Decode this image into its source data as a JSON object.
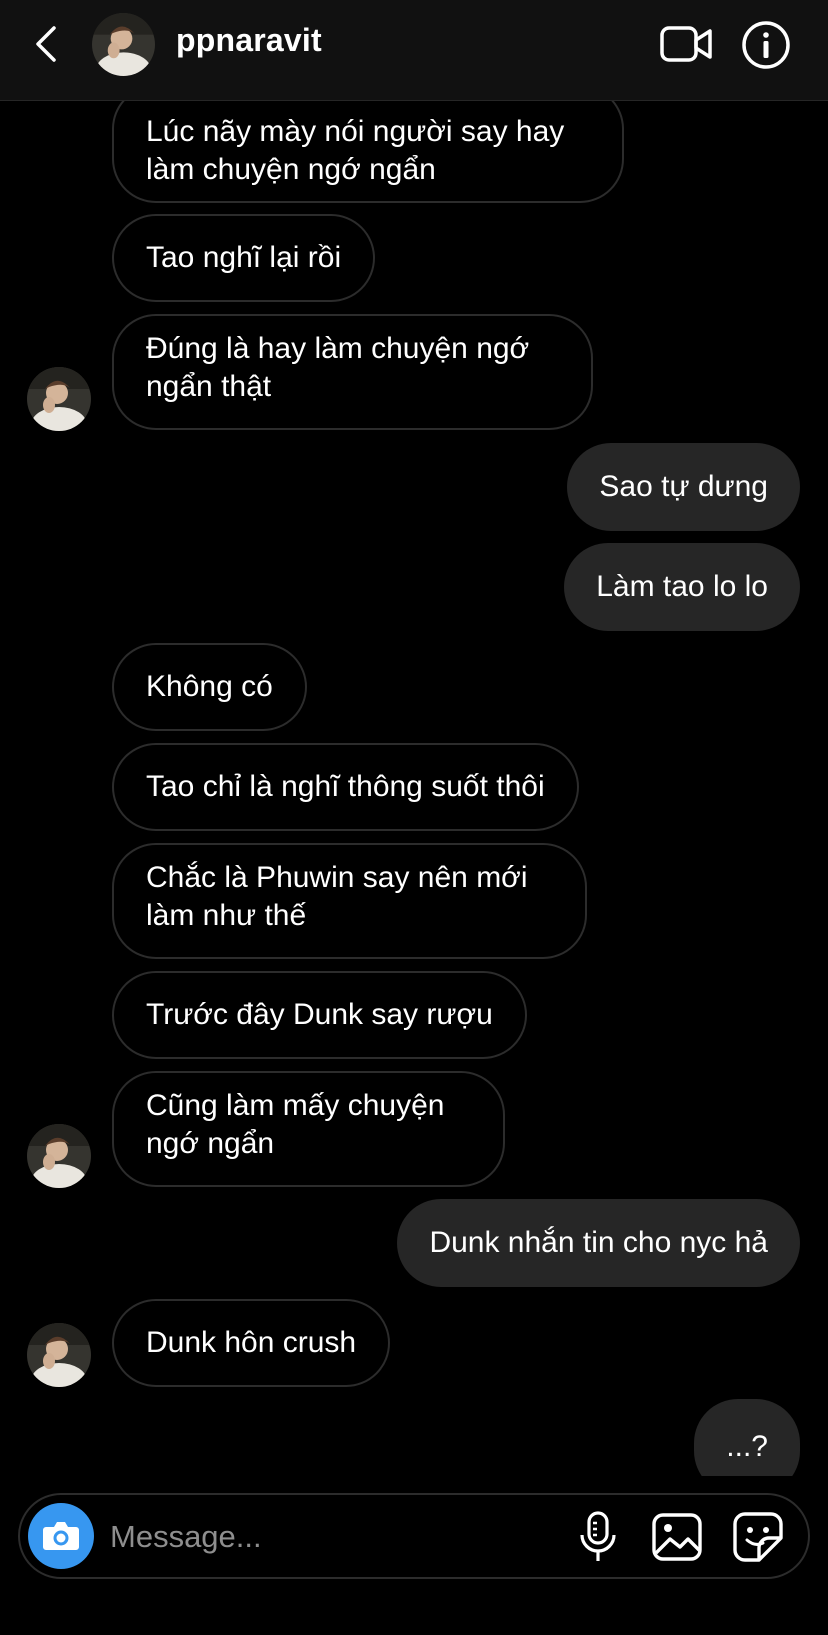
{
  "header": {
    "username": "ppnaravit",
    "icons": {
      "back": "chevron-left-icon",
      "video": "video-camera-icon",
      "info": "info-icon"
    }
  },
  "messages": [
    {
      "from": "them",
      "text": "Lúc nãy mày nói người say hay làm chuyện ngớ ngẩn"
    },
    {
      "from": "them",
      "text": "Tao nghĩ lại rồi"
    },
    {
      "from": "them",
      "text": "Đúng là hay làm chuyện ngớ ngẩn thật"
    },
    {
      "from": "me",
      "text": "Sao tự dưng"
    },
    {
      "from": "me",
      "text": "Làm tao lo lo"
    },
    {
      "from": "them",
      "text": "Không có"
    },
    {
      "from": "them",
      "text": "Tao chỉ là nghĩ thông suốt thôi"
    },
    {
      "from": "them",
      "text": "Chắc là Phuwin say nên mới làm như thế"
    },
    {
      "from": "them",
      "text": "Trước đây Dunk say rượu"
    },
    {
      "from": "them",
      "text": "Cũng làm mấy chuyện ngớ ngẩn"
    },
    {
      "from": "me",
      "text": "Dunk nhắn tin cho nyc hả"
    },
    {
      "from": "them",
      "text": "Dunk hôn crush"
    },
    {
      "from": "me",
      "text": "...?"
    }
  ],
  "composer": {
    "placeholder": "Message...",
    "icons": {
      "camera": "camera-icon",
      "mic": "microphone-icon",
      "gallery": "image-icon",
      "sticker": "sticker-icon"
    },
    "accent": "#3797f0"
  },
  "colors": {
    "background": "#000000",
    "header": "#111111",
    "outgoing_bubble": "#262626",
    "incoming_border": "#2c2c2c"
  }
}
